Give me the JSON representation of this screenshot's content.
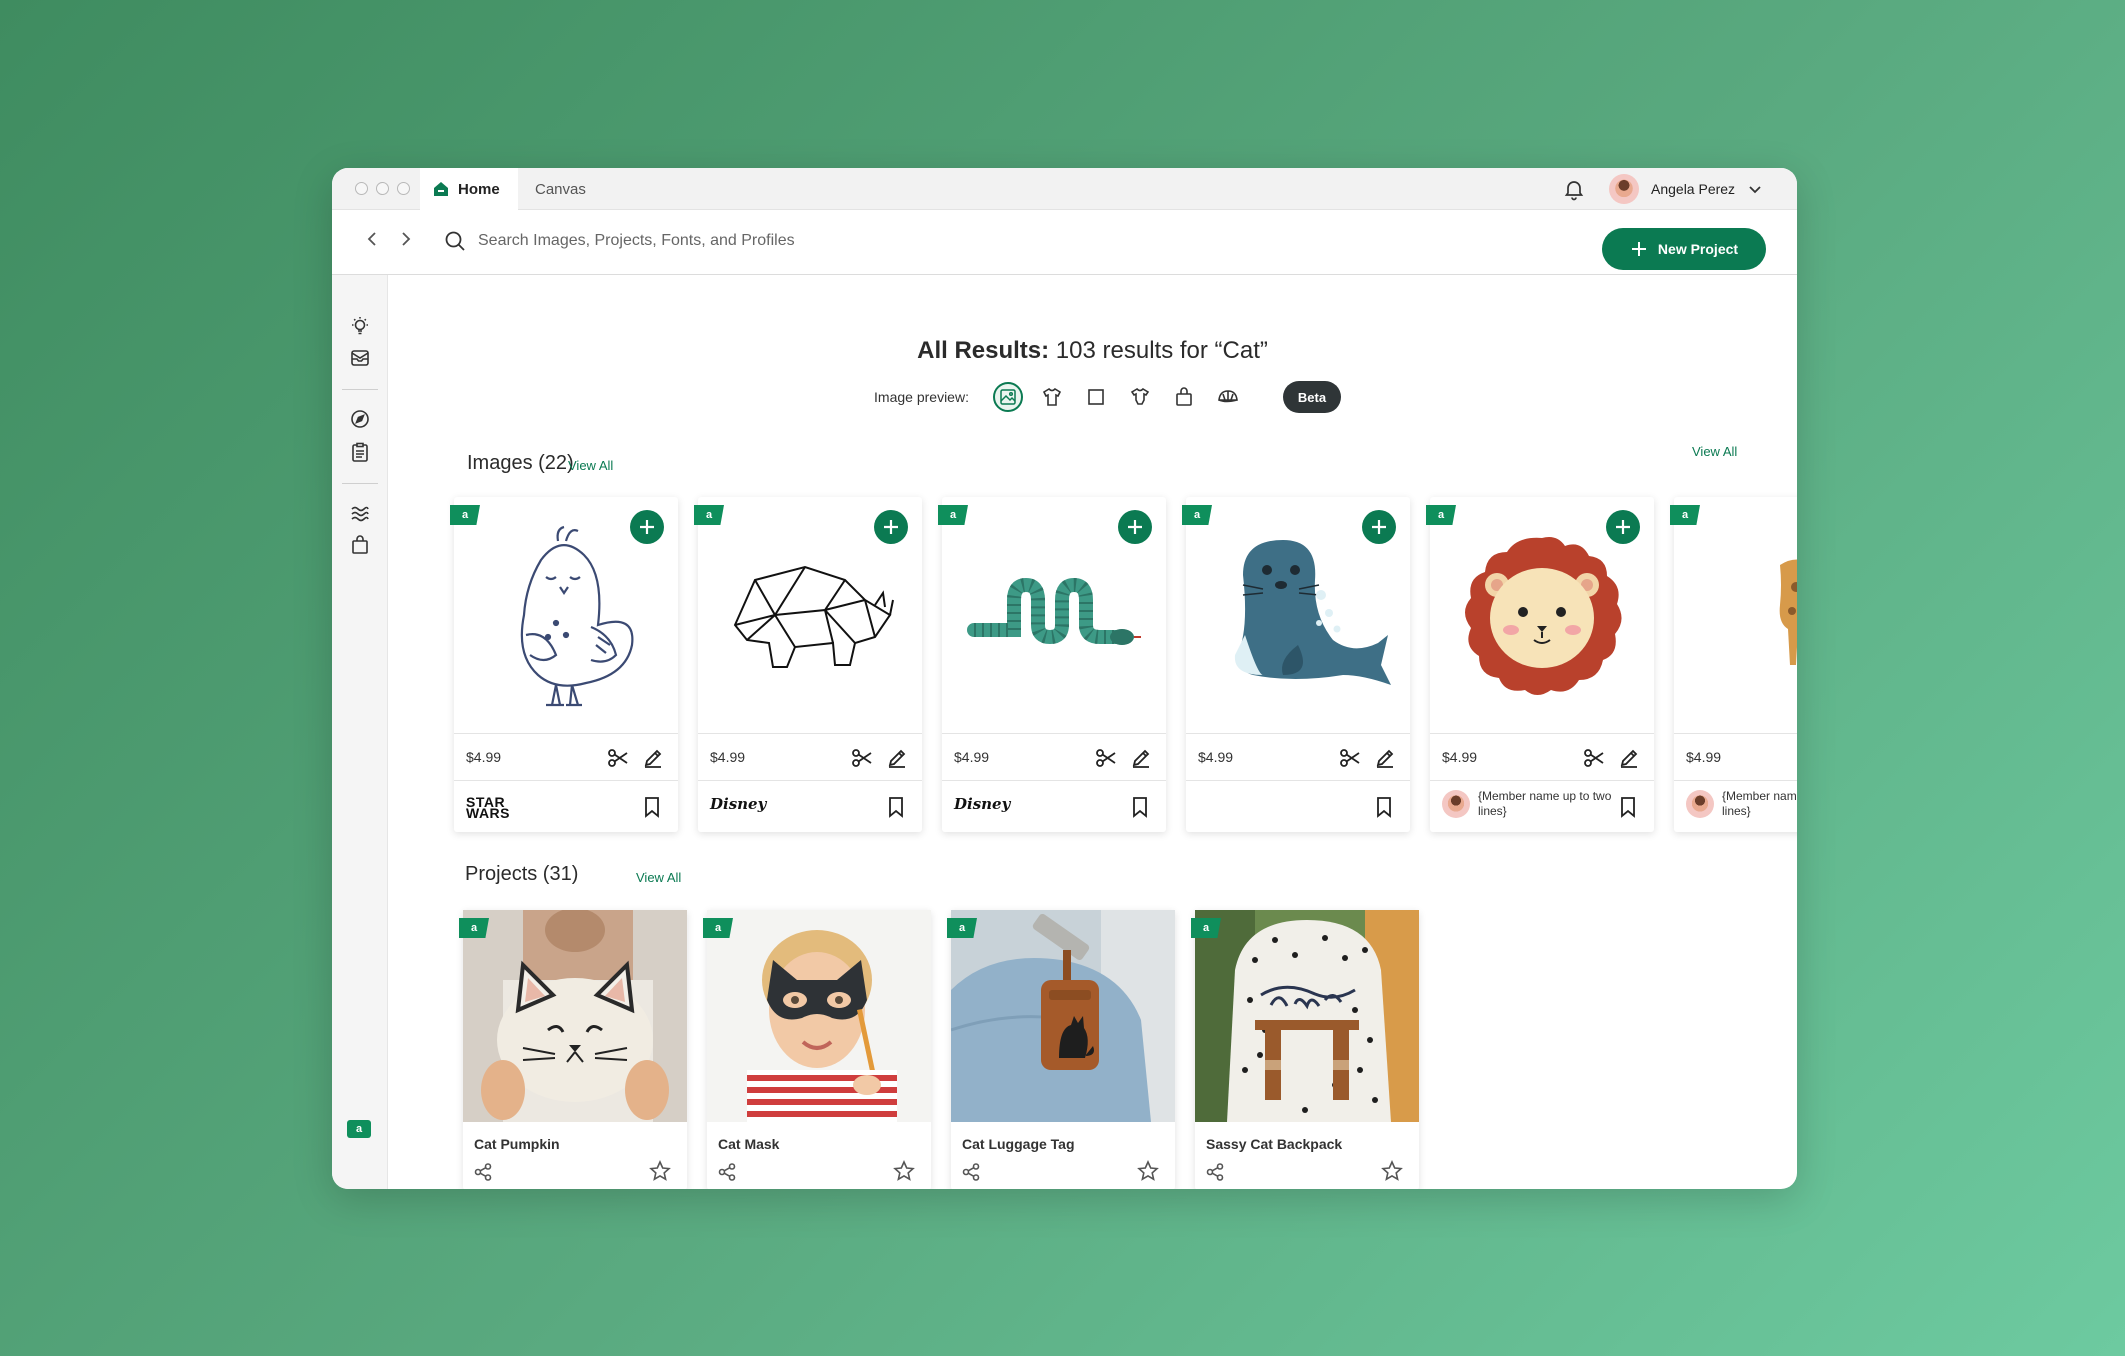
{
  "window": {
    "tabs": [
      {
        "label": "Home",
        "active": true
      },
      {
        "label": "Canvas",
        "active": false
      }
    ],
    "user": {
      "name": "Angela Perez"
    }
  },
  "toolbar": {
    "search_placeholder": "Search Images, Projects, Fonts, and Profiles",
    "new_project_label": "New Project"
  },
  "sidebar": {
    "icons": [
      "lightbulb-icon",
      "inbox-icon",
      "compass-icon",
      "clipboard-icon",
      "waves-icon",
      "bag-icon"
    ]
  },
  "results": {
    "title_bold": "All Results:",
    "title_rest": " 103 results for “Cat”"
  },
  "image_preview": {
    "label": "Image preview:",
    "options": [
      "image-icon",
      "tshirt-icon",
      "square-icon",
      "onesie-icon",
      "tote-bag-icon",
      "cap-icon"
    ],
    "beta_label": "Beta"
  },
  "images_section": {
    "title": "Images (22)",
    "view_all": "View All",
    "view_all_right": "View All",
    "cards": [
      {
        "art": "bird",
        "price": "$4.99",
        "brand": "STAR\nWARS",
        "brand_type": "starwars"
      },
      {
        "art": "rhino",
        "price": "$4.99",
        "brand": "Disney",
        "brand_type": "disney"
      },
      {
        "art": "snake",
        "price": "$4.99",
        "brand": "Disney",
        "brand_type": "disney"
      },
      {
        "art": "seal",
        "price": "$4.99",
        "brand": "",
        "brand_type": "none"
      },
      {
        "art": "lion",
        "price": "$4.99",
        "brand": "{Member name up to two lines}",
        "brand_type": "member"
      },
      {
        "art": "giraffe",
        "price": "$4.99",
        "brand": "{Member name up to two lines}",
        "brand_type": "member"
      }
    ],
    "badge": "a"
  },
  "projects_section": {
    "title": "Projects (31)",
    "view_all": "View All",
    "cards": [
      {
        "name": "Cat Pumpkin"
      },
      {
        "name": "Cat Mask"
      },
      {
        "name": "Cat Luggage Tag"
      },
      {
        "name": "Sassy Cat Backpack"
      }
    ]
  },
  "colors": {
    "brand_green": "#0b7a52",
    "badge_green": "#0f8f5c",
    "beta_bg": "#2f3537"
  }
}
